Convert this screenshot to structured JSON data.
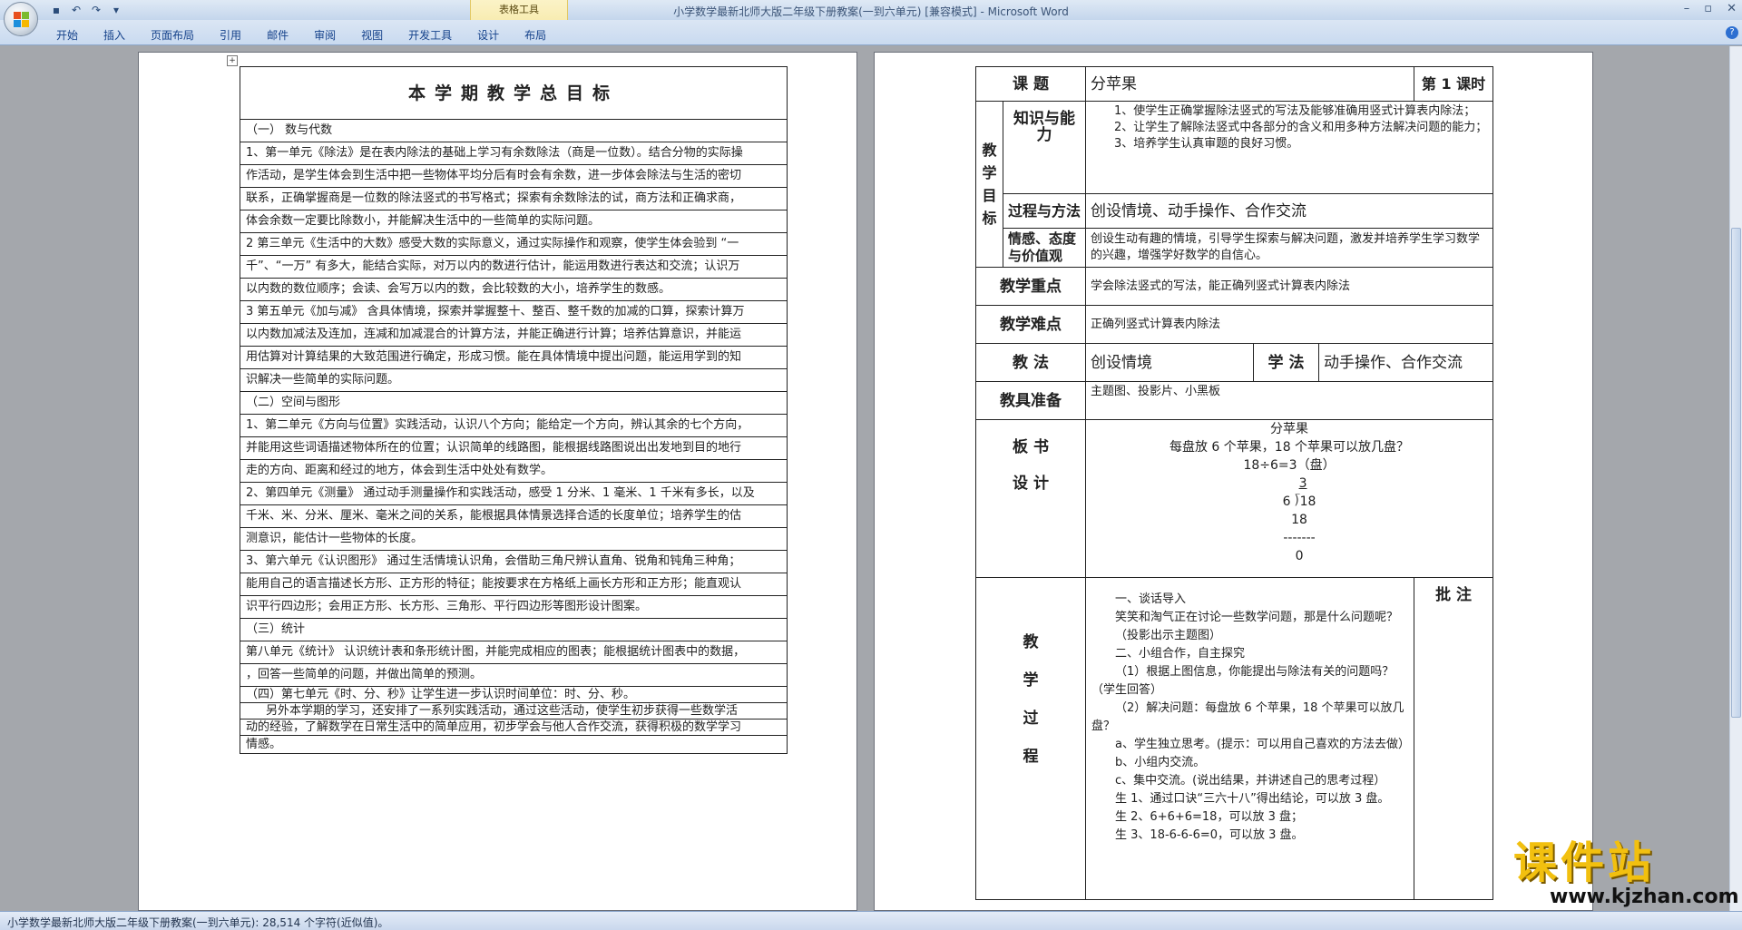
{
  "window": {
    "title": "小学数学最新北师大版二年级下册教案(一到六单元) [兼容模式] - ",
    "app_name": "Microsoft Word",
    "context_tab": "表格工具"
  },
  "ribbon": {
    "tabs": [
      "开始",
      "插入",
      "页面布局",
      "引用",
      "邮件",
      "审阅",
      "视图",
      "开发工具",
      "设计",
      "布局"
    ]
  },
  "status": {
    "text": "小学数学最新北师大版二年级下册教案(一到六单元): 28,514 个字符(近似值)。"
  },
  "left_page": {
    "title": "本学期教学总目标",
    "rows": [
      "（一） 数与代数",
      "1、第一单元《除法》是在表内除法的基础上学习有余数除法（商是一位数）。结合分物的实际操",
      "作活动，是学生体会到生活中把一些物体平均分后有时会有余数，进一步体会除法与生活的密切",
      "联系，正确掌握商是一位数的除法竖式的书写格式；探索有余数除法的试，商方法和正确求商，",
      "体会余数一定要比除数小，并能解决生活中的一些简单的实际问题。",
      "2 第三单元《生活中的大数》感受大数的实际意义，通过实际操作和观察，使学生体会验到 “一",
      "千”、“一万” 有多大，能结合实际，对万以内的数进行估计，能运用数进行表达和交流；认识万",
      "以内数的数位顺序；会读、会写万以内的数，会比较数的大小，培养学生的数感。",
      "3 第五单元《加与减》 含具体情境，探索并掌握整十、整百、整千数的加减的口算，探索计算万",
      "以内数加减法及连加，连减和加减混合的计算方法，并能正确进行计算；培养估算意识，并能运",
      "用估算对计算结果的大致范围进行确定，形成习惯。能在具体情境中提出问题，能运用学到的知",
      "识解决一些简单的实际问题。",
      "（二）空间与图形",
      "1、第二单元《方向与位置》实践活动，认识八个方向；能给定一个方向，辨认其余的七个方向，",
      "并能用这些词语描述物体所在的位置；认识简单的线路图，能根据线路图说出出发地到目的地行",
      "走的方向、距离和经过的地方，体会到生活中处处有数学。",
      "2、第四单元《测量》 通过动手测量操作和实践活动，感受 1 分米、1 毫米、1 千米有多长，以及",
      "千米、米、分米、厘米、毫米之间的关系，能根据具体情景选择合适的长度单位；培养学生的估",
      "测意识，能估计一些物体的长度。",
      "3、第六单元《认识图形》 通过生活情境认识角，会借助三角尺辨认直角、锐角和钝角三种角；",
      "能用自己的语言描述长方形、正方形的特征；能按要求在方格纸上画长方形和正方形；能直观认",
      "识平行四边形；会用正方形、长方形、三角形、平行四边形等图形设计图案。",
      "（三）统计",
      "第八单元《统计》 认识统计表和条形统计图，并能完成相应的图表；能根据统计图表中的数据，",
      "，回答一些简单的问题，并做出简单的预测。",
      "（四）第七单元《时、分、秒》让学生进一步认识时间单位：时、分、秒。",
      "另外本学期的学习，还安排了一系列实践活动，通过这些活动，使学生初步获得一些数学活",
      "动的经验，了解数学在日常生活中的简单应用，初步学会与他人合作交流，获得积极的数学学习",
      "情感。"
    ]
  },
  "right_page": {
    "topic_label": "课 题",
    "topic": "分苹果",
    "lesson": "第 1 课时",
    "goals_label": "教学目标",
    "ka_label": "知识与能力",
    "ka_items": [
      "1、使学生正确掌握除法竖式的写法及能够准确用竖式计算表内除法；",
      "2、让学生了解除法竖式中各部分的含义和用多种方法解决问题的能力；",
      "3、培养学生认真审题的良好习惯。"
    ],
    "pm_label": "过程与方法",
    "pm": "创设情境、动手操作、合作交流",
    "ev_label": "情感、态度与价值观",
    "ev": "创设生动有趣的情境，引导学生探索与解决问题，激发并培养学生学习数学的兴趣，增强学好数学的自信心。",
    "key_label": "教学重点",
    "key": "学会除法竖式的写法，能正确列竖式计算表内除法",
    "diff_label": "教学难点",
    "diff": "正确列竖式计算表内除法",
    "method_label": "教 法",
    "method": "创设情境",
    "learn_label": "学 法",
    "learn": "动手操作、合作交流",
    "prep_label": "教具准备",
    "prep": "主题图、投影片、小黑板",
    "board_label1": "板 书",
    "board_label2": "设 计",
    "board_lines": [
      "分苹果",
      "每盘放 6 个苹果，18 个苹果可以放几盘？",
      "18÷6=3（盘）",
      "3",
      "6 ⟌18",
      "18",
      "-------",
      "0"
    ],
    "process_label": [
      "教",
      "学",
      "过",
      "程"
    ],
    "remark_label": "批 注",
    "process": [
      "一、谈话导入",
      "笑笑和淘气正在讨论一些数学问题，那是什么问题呢？",
      "（投影出示主题图）",
      "二、小组合作，自主探究",
      "（1）根据上图信息，你能提出与除法有关的问题吗？（学生回答）",
      "（2）解决问题：每盘放 6 个苹果，18 个苹果可以放几盘？",
      "a、学生独立思考。(提示：可以用自己喜欢的方法去做）",
      "b、小组内交流。",
      "c、集中交流。(说出结果，并讲述自己的思考过程）",
      "生 1、通过口诀“三六十八”得出结论，可以放 3 盘。",
      "生 2、6+6+6=18，可以放 3 盘；",
      "生 3、18-6-6-6=0，可以放 3 盘。"
    ]
  },
  "watermark": {
    "cn": "课件站",
    "url": "www.kjzhan.com"
  },
  "colors": {
    "ribbon": "#c9daf0",
    "context_tab": "#f6e7a3",
    "page_bg": "#ffffff",
    "workspace": "#a4a7ac",
    "watermark": "#f2c00f"
  }
}
